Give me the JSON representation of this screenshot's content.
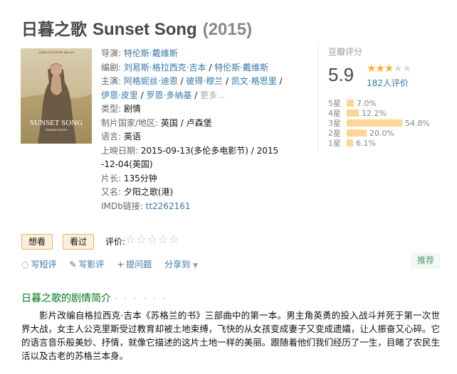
{
  "title": {
    "cn": "日暮之歌",
    "en": "Sunset Song",
    "year": "(2015)"
  },
  "info": {
    "director_label": "导演:",
    "director": "特伦斯·戴维斯",
    "writer_label": "编剧:",
    "writers": [
      "刘易斯·格拉西克·吉本",
      "特伦斯·戴维斯"
    ],
    "cast_label": "主演:",
    "cast": [
      "阿格妮丝·迪恩",
      "彼得·穆兰",
      "凯文·格思里",
      "伊恩·皮里",
      "罗恩·多纳基"
    ],
    "more": "更多...",
    "genre_label": "类型:",
    "genre": "剧情",
    "country_label": "制片国家/地区:",
    "country": "英国 / 卢森堡",
    "language_label": "语言:",
    "language": "英语",
    "release_label": "上映日期:",
    "release": "2015-09-13(多伦多电影节) / 2015-12-04(英国)",
    "runtime_label": "片长:",
    "runtime": "135分钟",
    "aka_label": "又名:",
    "aka": "夕阳之歌(港)",
    "imdb_label": "IMDb链接:",
    "imdb": "tt2262161"
  },
  "poster": {
    "top_text": "AGNES DEYN  PETER MULLAN",
    "name": "SUNSET SONG",
    "director": "TERENCE DAVIES"
  },
  "rating": {
    "title": "豆瓣评分",
    "score": "5.9",
    "stars_on": 3,
    "votes": "182人评价",
    "breakdown": [
      {
        "label": "5星",
        "pct": "7.0%",
        "value": 7.0
      },
      {
        "label": "4星",
        "pct": "12.2%",
        "value": 12.2
      },
      {
        "label": "3星",
        "pct": "54.8%",
        "value": 54.8
      },
      {
        "label": "2星",
        "pct": "20.0%",
        "value": 20.0
      },
      {
        "label": "1星",
        "pct": "6.1%",
        "value": 6.1
      }
    ],
    "bar_color": "#ffd596",
    "star_color": "#ffac2d"
  },
  "actions": {
    "want": "想看",
    "seen": "看过",
    "rate_label": "评价:",
    "write_short": "写短评",
    "write_review": "写影评",
    "ask": "提问题",
    "share": "分享到",
    "recommend": "推荐"
  },
  "summary": {
    "title": "日暮之歌的剧情简介",
    "dots": "· · · · · ·",
    "text": "影片改编自格拉西克·吉本《苏格兰的书》三部曲中的第一本。男主角英勇的投入战斗并死于第一次世界大战，女主人公克里斯受过教育却被土地束缚，飞快的从女孩变成妻子又变成遗孀，让人振奋又心碎。它的语言音乐般美妙、抒情，就像它描述的这片土地一样的美丽。跟随着他们我们经历了一生，目睹了农民生活以及古老的苏格兰本身。"
  }
}
